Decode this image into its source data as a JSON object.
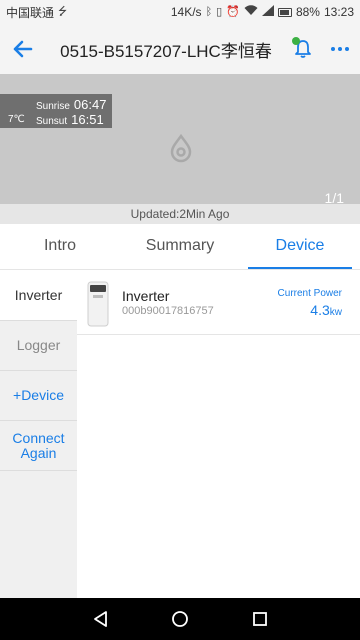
{
  "status_bar": {
    "carrier": "中国联通",
    "net_speed": "14K/s",
    "battery": "88%",
    "time": "13:23"
  },
  "header": {
    "title": "0515-B5157207-LHC李恒春",
    "back_icon": "back-arrow-icon",
    "bell_icon": "bell-icon",
    "more_icon": "more-icon",
    "accent": "#1a7ee6"
  },
  "banner": {
    "temperature": "7℃",
    "sunrise_label": "Sunrise",
    "sunrise_time": "06:47",
    "sunset_label": "Sunsut",
    "sunset_time": "16:51",
    "pager": "1/1",
    "updated": "Updated:2Min Ago"
  },
  "tabs": [
    {
      "label": "Intro",
      "active": false
    },
    {
      "label": "Summary",
      "active": false
    },
    {
      "label": "Device",
      "active": true
    }
  ],
  "sidebar": {
    "items": [
      {
        "label": "Inverter"
      },
      {
        "label": "Logger"
      },
      {
        "label": "+Device"
      },
      {
        "label": "Connect Again"
      }
    ]
  },
  "device": {
    "name": "Inverter",
    "serial": "000b90017816757",
    "power_label": "Current Power",
    "power_value": "4.3",
    "power_unit": "kw"
  }
}
